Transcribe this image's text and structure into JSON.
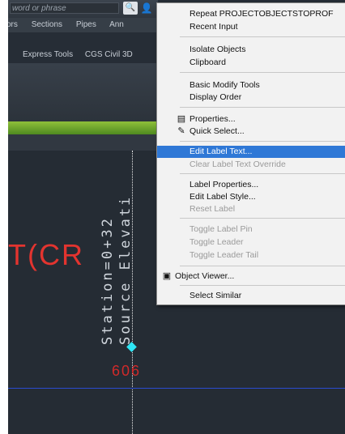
{
  "ribbon": {
    "search_placeholder": "word or phrase",
    "tabs_top": [
      "ors",
      "Sections",
      "Pipes",
      "Ann"
    ],
    "tabs_row2": [
      "Express Tools",
      "CGS Civil 3D"
    ]
  },
  "drawing": {
    "big_text": "T(CR",
    "station_text": "Station=0+32",
    "source_text": "Source Elevati",
    "red_number": "606",
    "colors": {
      "red": "#e3342f",
      "cyan": "#2ee6f5",
      "blue": "#2a4bd0",
      "highlight": "#2f78d6"
    }
  },
  "menu": {
    "items": [
      {
        "label": "Repeat PROJECTOBJECTSTOPROF",
        "enabled": true
      },
      {
        "label": "Recent Input",
        "enabled": true,
        "submenu": true
      },
      {
        "label": "Isolate Objects",
        "enabled": true,
        "submenu": true
      },
      {
        "label": "Clipboard",
        "enabled": true,
        "submenu": true
      },
      {
        "label": "Basic Modify Tools",
        "enabled": true,
        "submenu": true
      },
      {
        "label": "Display Order",
        "enabled": true,
        "submenu": true
      },
      {
        "label": "Properties...",
        "enabled": true,
        "icon": "properties-icon"
      },
      {
        "label": "Quick Select...",
        "enabled": true,
        "icon": "quick-select-icon"
      },
      {
        "label": "Edit Label Text...",
        "enabled": true,
        "highlighted": true
      },
      {
        "label": "Clear Label Text Override",
        "enabled": false
      },
      {
        "label": "Label Properties...",
        "enabled": true
      },
      {
        "label": "Edit Label Style...",
        "enabled": true
      },
      {
        "label": "Reset Label",
        "enabled": false
      },
      {
        "label": "Toggle Label Pin",
        "enabled": false
      },
      {
        "label": "Toggle Leader",
        "enabled": false
      },
      {
        "label": "Toggle Leader Tail",
        "enabled": false
      },
      {
        "label": "Object Viewer...",
        "enabled": true,
        "icon": "object-viewer-icon"
      },
      {
        "label": "Select Similar",
        "enabled": true
      }
    ]
  }
}
